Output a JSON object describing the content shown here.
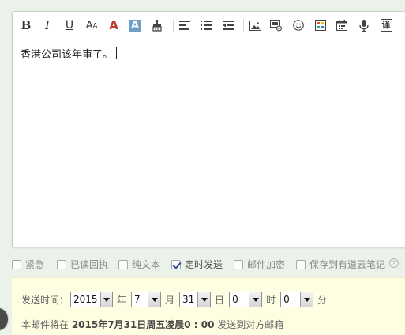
{
  "editor": {
    "body_text": "香港公司该年审了。"
  },
  "options": {
    "urgent": "紧急",
    "read_receipt": "已读回执",
    "plain_text": "纯文本",
    "scheduled_send": "定时发送",
    "encrypt": "邮件加密",
    "save_to_cloud_note": "保存到有道云笔记",
    "help": "?"
  },
  "schedule": {
    "label": "发送时间：",
    "year_value": "2015",
    "year_unit": "年",
    "month_value": "7",
    "month_unit": "月",
    "day_value": "31",
    "day_unit": "日",
    "hour_value": "0",
    "hour_unit": "时",
    "minute_value": "0",
    "minute_unit": "分",
    "notice_prefix": "本邮件将在 ",
    "notice_time": "2015年7月31日周五凌晨0 : 00",
    "notice_suffix": " 发送到对方邮箱"
  },
  "colors": {
    "background": "#eaf2ea",
    "schedule_bg": "#fefee3",
    "font_color_red": "#c0392b",
    "highlight_blue": "#6fa0c8",
    "check_blue": "#2a4f96"
  }
}
